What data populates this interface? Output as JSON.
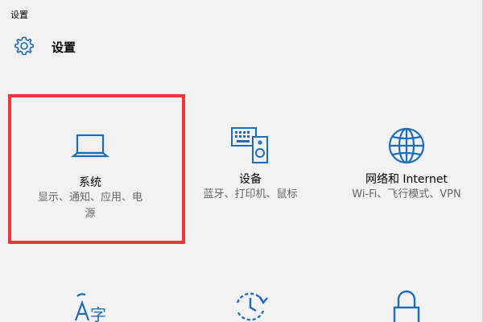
{
  "window": {
    "title": "设置"
  },
  "header": {
    "title": "设置",
    "icon": "gear-icon"
  },
  "colors": {
    "accent": "#1e6bb8",
    "highlight": "#e8393b",
    "secondary_text": "#666666"
  },
  "tiles": [
    {
      "name": "系统",
      "desc_line1": "显示、通知、应用、电",
      "desc_line2": "源",
      "icon": "laptop-icon"
    },
    {
      "name": "设备",
      "desc_line1": "蓝牙、打印机、鼠标",
      "icon": "devices-icon"
    },
    {
      "name": "网络和 Internet",
      "desc_line1": "Wi-Fi、飞行模式、VPN",
      "icon": "globe-icon"
    },
    {
      "icon": "language-icon"
    },
    {
      "icon": "update-icon"
    },
    {
      "icon": "lock-icon"
    }
  ]
}
